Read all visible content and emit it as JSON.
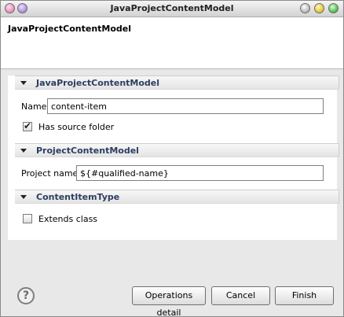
{
  "window": {
    "title": "JavaProjectContentModel"
  },
  "header": {
    "title": "JavaProjectContentModel"
  },
  "sections": [
    {
      "title": "JavaProjectContentModel",
      "fields": {
        "name_label": "Name",
        "name_value": "content-item",
        "has_source_label": "Has source folder",
        "has_source_checked": true
      }
    },
    {
      "title": "ProjectContentModel",
      "fields": {
        "project_name_label": "Project name",
        "project_name_value": "${#qualified-name}"
      }
    },
    {
      "title": "ContentItemType",
      "fields": {
        "extends_label": "Extends class",
        "extends_checked": false
      }
    }
  ],
  "buttons": {
    "help": "?",
    "operations_detail": "Operations detail",
    "cancel": "Cancel",
    "finish": "Finish"
  },
  "colors": {
    "section_title": "#2c3e60",
    "title_close": "#e68ab7",
    "title_minimize": "#e0c030",
    "title_maximize": "#4bb84b"
  }
}
